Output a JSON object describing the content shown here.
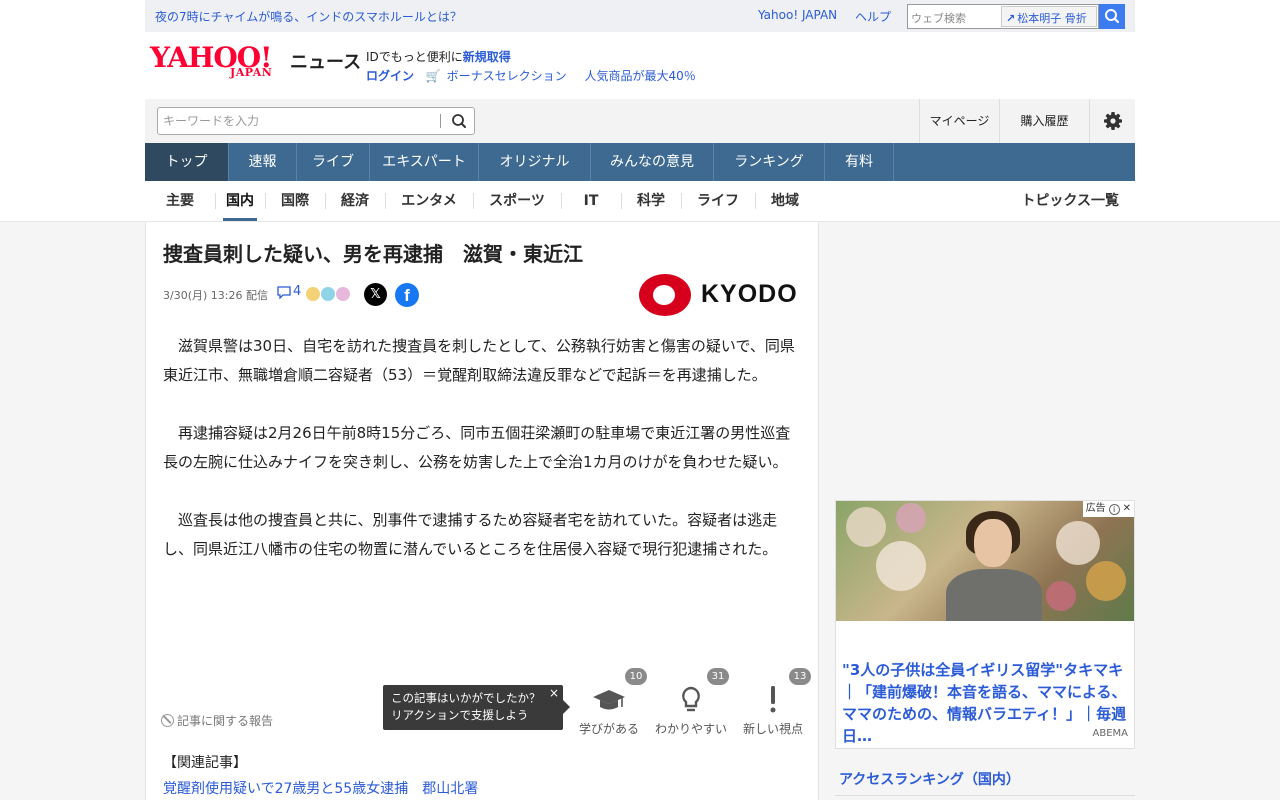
{
  "header": {
    "promo_link": "夜の7時にチャイムが鳴る、インドのスマホルールとは？",
    "yahoo_japan_link": "Yahoo! JAPAN",
    "help_link": "ヘルプ",
    "web_search_placeholder": "ウェブ検索",
    "web_search_suggestion": "松本明子 骨折",
    "logo_yahoo": "YAHOO!",
    "logo_japan": "JAPAN",
    "service_name": "ニュース",
    "id_promo_text": "IDでもっと便利に",
    "id_promo_link": "新規取得",
    "login_link": "ログイン",
    "bonus_link": "ボーナスセレクション",
    "popular_link": "人気商品が最大40％"
  },
  "search": {
    "placeholder": "キーワードを入力",
    "mypage": "マイページ",
    "history": "購入履歴"
  },
  "main_nav": [
    "トップ",
    "速報",
    "ライブ",
    "エキスパート",
    "オリジナル",
    "みんなの意見",
    "ランキング",
    "有料"
  ],
  "sub_nav": [
    "主要",
    "国内",
    "国際",
    "経済",
    "エンタメ",
    "スポーツ",
    "IT",
    "科学",
    "ライフ",
    "地域"
  ],
  "topics_link": "トピックス一覧",
  "article": {
    "headline": "捜査員刺した疑い、男を再逮捕　滋賀・東近江",
    "datetime": "3/30(月) 13:26 配信",
    "comment_count": "4",
    "source": "KYODO",
    "paragraphs": [
      "滋賀県警は30日、自宅を訪れた捜査員を刺したとして、公務執行妨害と傷害の疑いで、同県東近江市、無職増倉順二容疑者（53）＝覚醒剤取締法違反罪などで起訴＝を再逮捕した。",
      "再逮捕容疑は2月26日午前8時15分ごろ、同市五個荘梁瀬町の駐車場で東近江署の男性巡査長の左腕に仕込みナイフを突き刺し、公務を妨害した上で全治1カ月のけがを負わせた疑い。",
      "巡査長は他の捜査員と共に、別事件で逮捕するため容疑者宅を訪れていた。容疑者は逃走し、同県近江八幡市の住宅の物置に潜んでいるところを住居侵入容疑で現行犯逮捕された。"
    ],
    "report_link": "記事に関する報告",
    "tooltip_line1": "この記事はいかがでしたか？",
    "tooltip_line2": "リアクションで支援しよう",
    "tooltip_close": "×",
    "reactions": [
      {
        "label": "学びがある",
        "count": "10",
        "icon": "graduation-cap-icon"
      },
      {
        "label": "わかりやすい",
        "count": "31",
        "icon": "lightbulb-icon"
      },
      {
        "label": "新しい視点",
        "count": "13",
        "icon": "exclamation-icon"
      }
    ],
    "related_heading": "【関連記事】",
    "related_link": "覚醒剤使用疑いで27歳男と55歳女逮捕　郡山北署"
  },
  "sidebar": {
    "ad_tag": "広告",
    "ad_title": "\"3人の子供は全員イギリス留学\"タキマキ｜「建前爆破！本音を語る、ママによる、ママのための、情報バラエティ！」｜毎週日…",
    "ad_sponsor": "ABEMA",
    "ranking_heading": "アクセスランキング（国内）"
  },
  "colors": {
    "nav_bg": "#3e6a91",
    "nav_active": "#2f4a60",
    "link": "#2b5bd7",
    "yahoo_red": "#ff0033",
    "kyodo_red": "#d6001c"
  }
}
